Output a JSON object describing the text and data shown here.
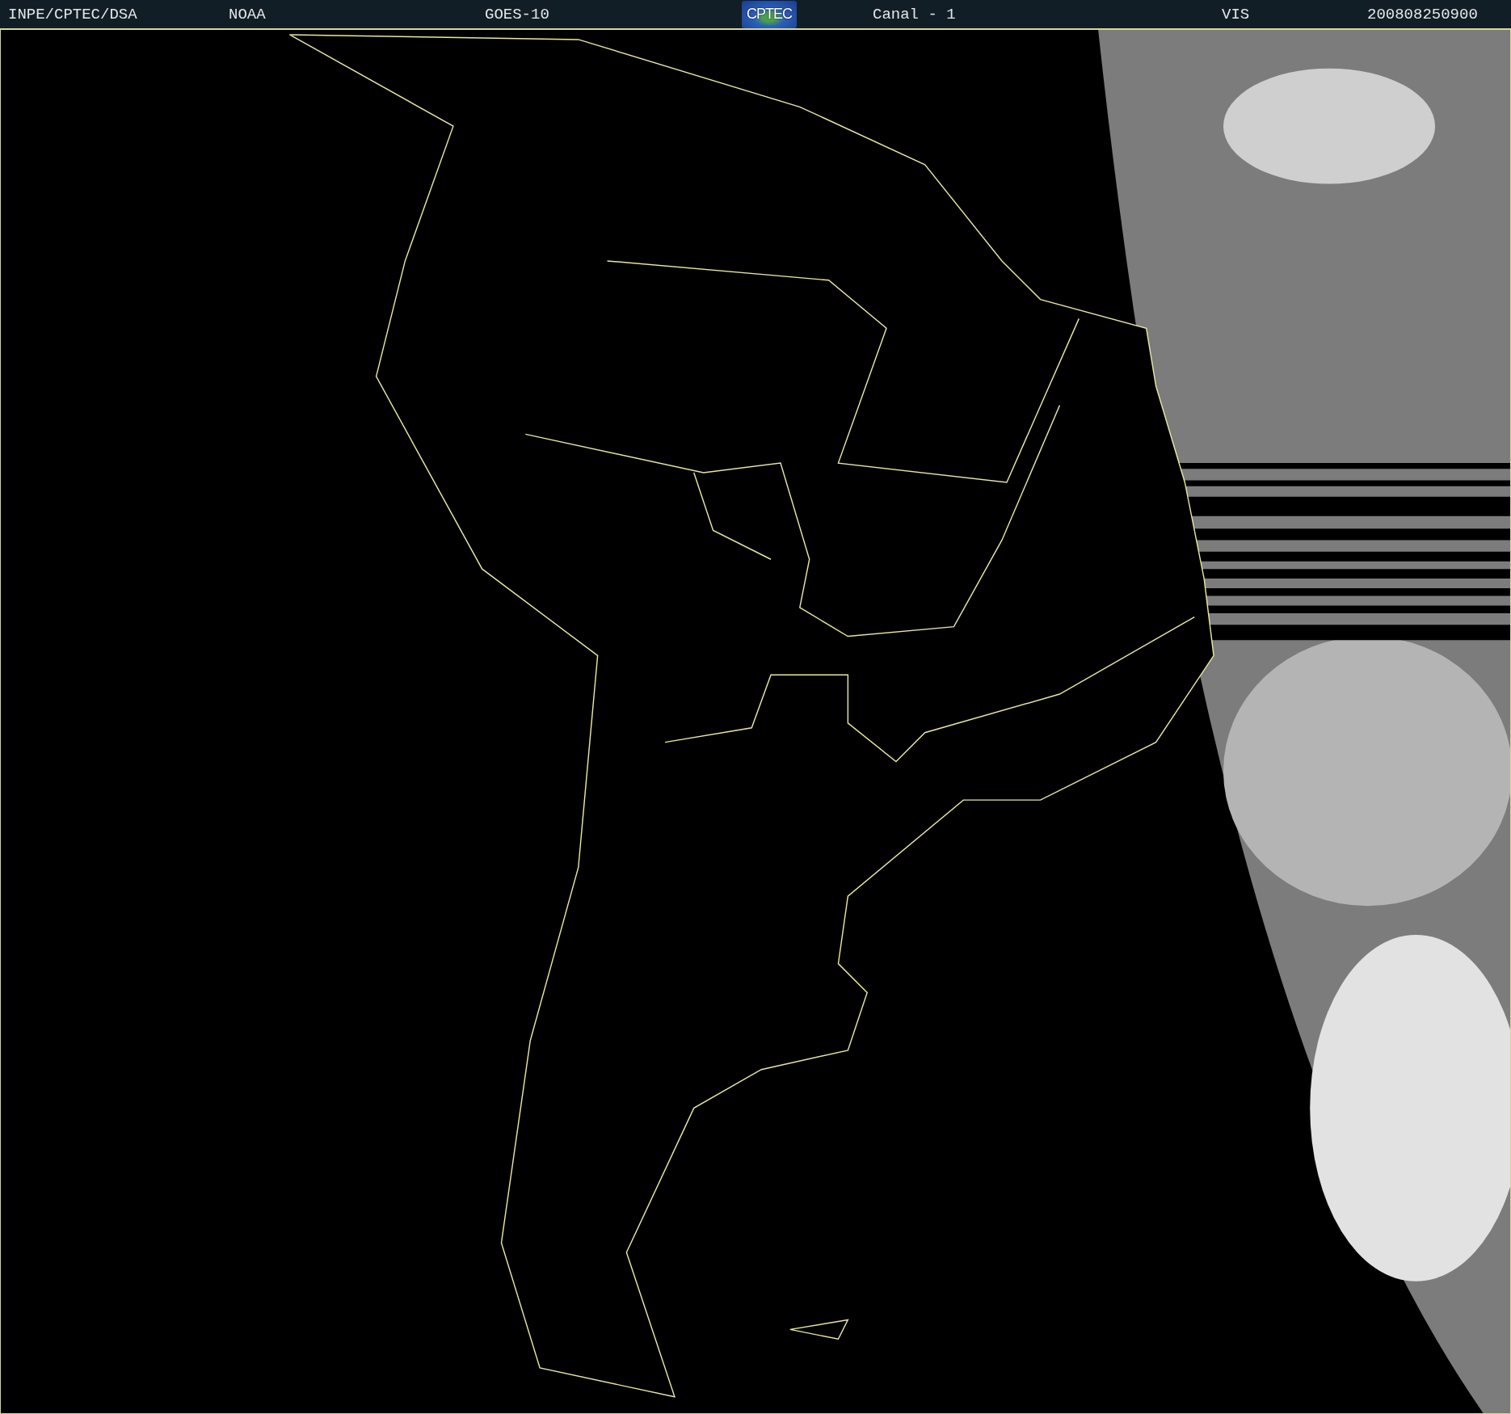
{
  "header": {
    "source": "INPE/CPTEC/DSA",
    "agency": "NOAA",
    "satellite": "GOES-10",
    "logo": "CPTEC",
    "channel": "Canal - 1",
    "band": "VIS",
    "timestamp": "200808250900"
  }
}
